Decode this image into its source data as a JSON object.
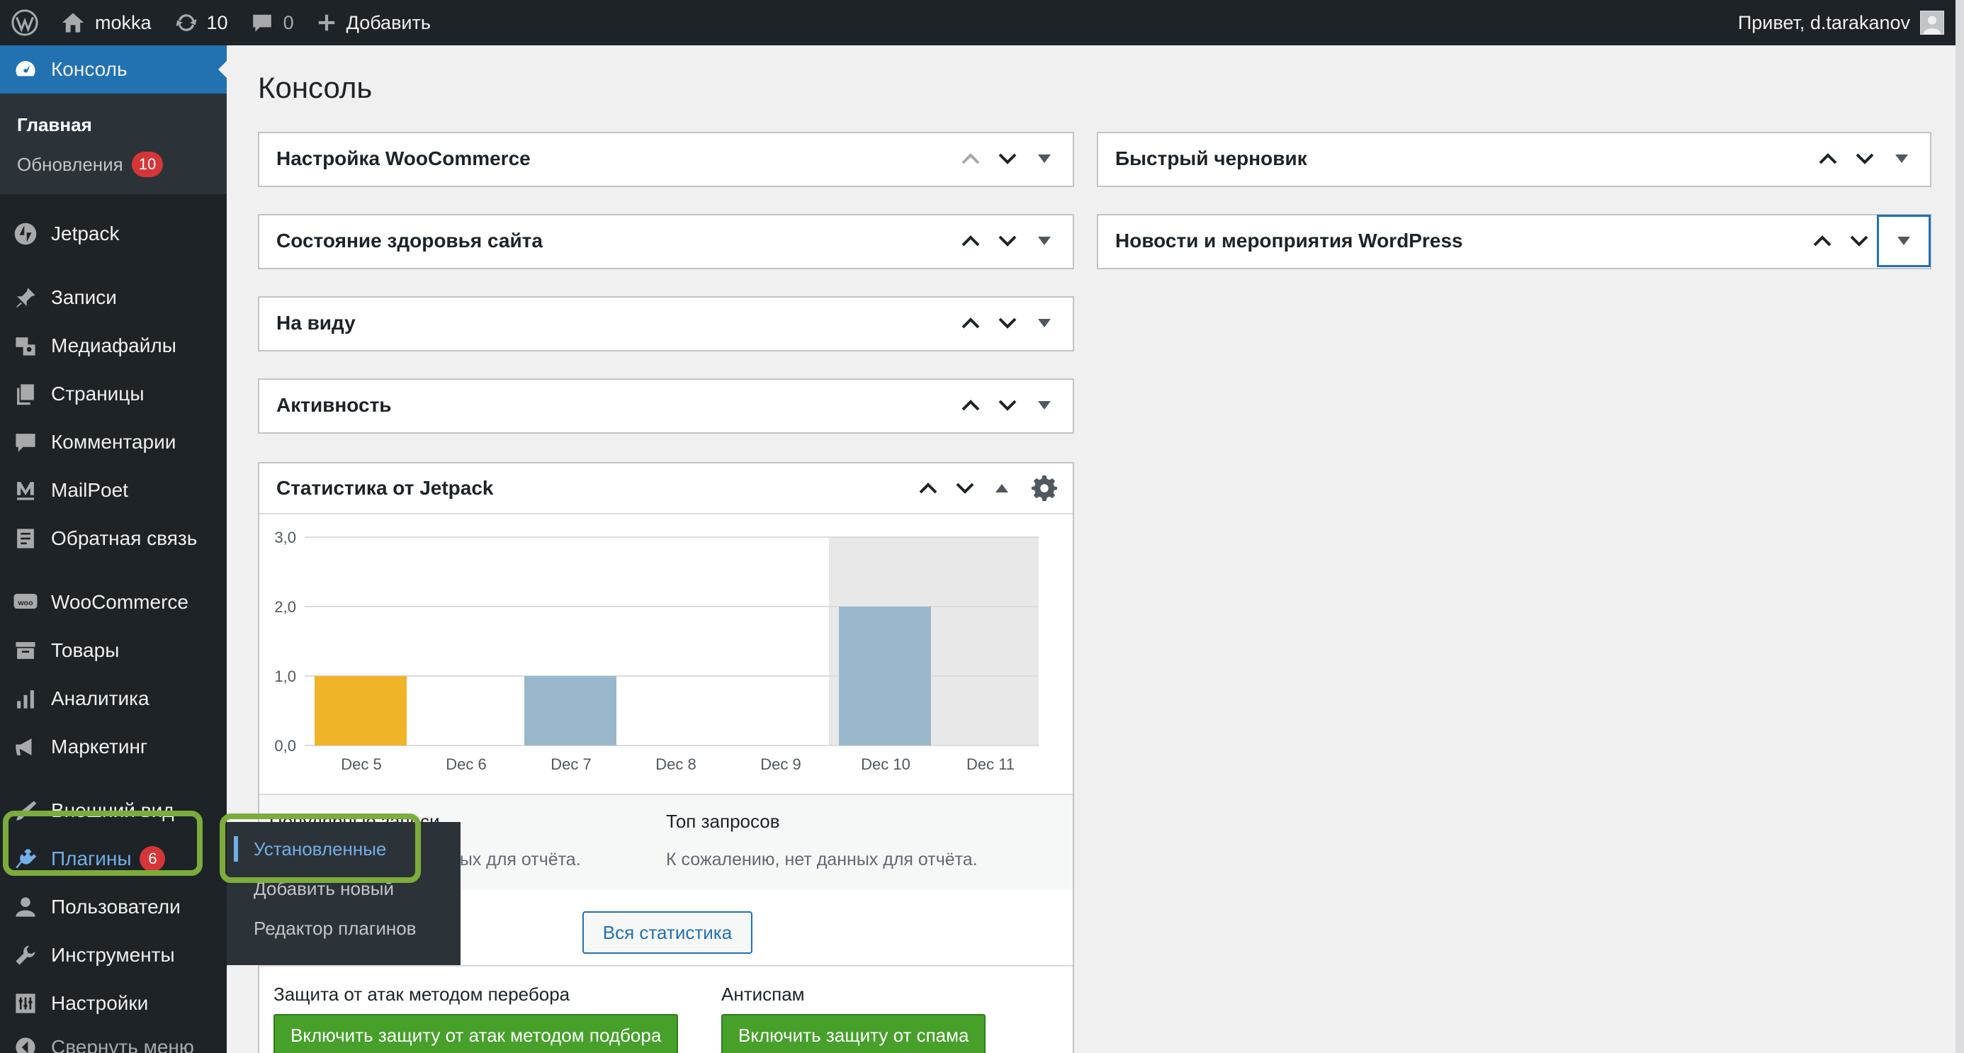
{
  "adminbar": {
    "site_name": "mokka",
    "updates_count": "10",
    "comments_count": "0",
    "add_new": "Добавить",
    "greeting": "Привет, d.tarakanov"
  },
  "sidebar": {
    "dashboard": "Консоль",
    "home": "Главная",
    "updates": "Обновления",
    "updates_badge": "10",
    "jetpack": "Jetpack",
    "posts": "Записи",
    "media": "Медиафайлы",
    "pages": "Страницы",
    "comments": "Комментарии",
    "mailpoet": "MailPoet",
    "feedback": "Обратная связь",
    "woocommerce": "WooCommerce",
    "products": "Товары",
    "analytics": "Аналитика",
    "marketing": "Маркетинг",
    "appearance": "Внешний вид",
    "plugins": "Плагины",
    "plugins_badge": "6",
    "users": "Пользователи",
    "tools": "Инструменты",
    "settings": "Настройки",
    "collapse": "Свернуть меню"
  },
  "flyout": {
    "installed": "Установленные",
    "add_new": "Добавить новый",
    "editor": "Редактор плагинов"
  },
  "page_title": "Консоль",
  "widgets": {
    "woo_setup": "Настройка WooCommerce",
    "site_health": "Состояние здоровья сайта",
    "at_a_glance": "На виду",
    "activity": "Активность",
    "jetpack_stats": "Статистика от Jetpack",
    "quick_draft": "Быстрый черновик",
    "wp_news": "Новости и мероприятия WordPress"
  },
  "stats": {
    "top_posts_heading": "Популярные записи",
    "top_posts_text": "К сожалению, нет данных для отчёта.",
    "top_searches_heading": "Топ запросов",
    "top_searches_text": "К сожалению, нет данных для отчёта.",
    "all_stats_button": "Вся статистика",
    "brute_heading": "Защита от атак методом перебора",
    "brute_button": "Включить защиту от атак методом подбора",
    "antispam_heading": "Антиспам",
    "antispam_button": "Включить защиту от спама"
  },
  "chart_data": {
    "type": "bar",
    "categories": [
      "Dec 5",
      "Dec 6",
      "Dec 7",
      "Dec 8",
      "Dec 9",
      "Dec 10",
      "Dec 11"
    ],
    "values": [
      1,
      0,
      1,
      0,
      0,
      2,
      0
    ],
    "ylim": [
      0,
      3
    ],
    "yticks": [
      "0,0",
      "1,0",
      "2,0",
      "3,0"
    ],
    "highlight_first_bar_color": "#f0b429",
    "bar_color": "#9ab8cc",
    "shaded_period_start": "Dec 10",
    "grid": true
  },
  "colors": {
    "admin_dark": "#1d2327",
    "accent_blue": "#2271b1",
    "highlight_green": "#7cac3b",
    "badge_red": "#d63638",
    "button_green": "#46a02a"
  }
}
